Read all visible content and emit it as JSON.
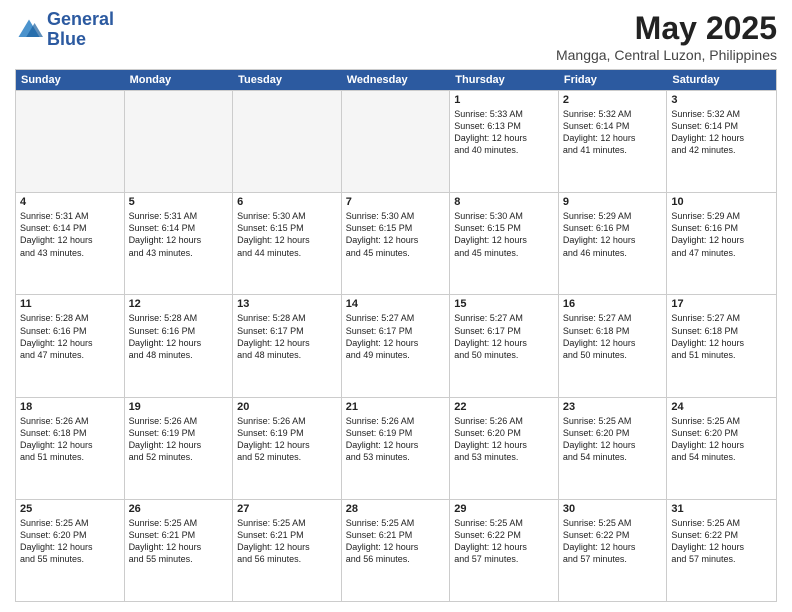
{
  "header": {
    "logo_line1": "General",
    "logo_line2": "Blue",
    "month": "May 2025",
    "location": "Mangga, Central Luzon, Philippines"
  },
  "weekdays": [
    "Sunday",
    "Monday",
    "Tuesday",
    "Wednesday",
    "Thursday",
    "Friday",
    "Saturday"
  ],
  "weeks": [
    [
      {
        "day": "",
        "empty": true
      },
      {
        "day": "",
        "empty": true
      },
      {
        "day": "",
        "empty": true
      },
      {
        "day": "",
        "empty": true
      },
      {
        "day": "1",
        "info": "Sunrise: 5:33 AM\nSunset: 6:13 PM\nDaylight: 12 hours\nand 40 minutes."
      },
      {
        "day": "2",
        "info": "Sunrise: 5:32 AM\nSunset: 6:14 PM\nDaylight: 12 hours\nand 41 minutes."
      },
      {
        "day": "3",
        "info": "Sunrise: 5:32 AM\nSunset: 6:14 PM\nDaylight: 12 hours\nand 42 minutes."
      }
    ],
    [
      {
        "day": "4",
        "info": "Sunrise: 5:31 AM\nSunset: 6:14 PM\nDaylight: 12 hours\nand 43 minutes."
      },
      {
        "day": "5",
        "info": "Sunrise: 5:31 AM\nSunset: 6:14 PM\nDaylight: 12 hours\nand 43 minutes."
      },
      {
        "day": "6",
        "info": "Sunrise: 5:30 AM\nSunset: 6:15 PM\nDaylight: 12 hours\nand 44 minutes."
      },
      {
        "day": "7",
        "info": "Sunrise: 5:30 AM\nSunset: 6:15 PM\nDaylight: 12 hours\nand 45 minutes."
      },
      {
        "day": "8",
        "info": "Sunrise: 5:30 AM\nSunset: 6:15 PM\nDaylight: 12 hours\nand 45 minutes."
      },
      {
        "day": "9",
        "info": "Sunrise: 5:29 AM\nSunset: 6:16 PM\nDaylight: 12 hours\nand 46 minutes."
      },
      {
        "day": "10",
        "info": "Sunrise: 5:29 AM\nSunset: 6:16 PM\nDaylight: 12 hours\nand 47 minutes."
      }
    ],
    [
      {
        "day": "11",
        "info": "Sunrise: 5:28 AM\nSunset: 6:16 PM\nDaylight: 12 hours\nand 47 minutes."
      },
      {
        "day": "12",
        "info": "Sunrise: 5:28 AM\nSunset: 6:16 PM\nDaylight: 12 hours\nand 48 minutes."
      },
      {
        "day": "13",
        "info": "Sunrise: 5:28 AM\nSunset: 6:17 PM\nDaylight: 12 hours\nand 48 minutes."
      },
      {
        "day": "14",
        "info": "Sunrise: 5:27 AM\nSunset: 6:17 PM\nDaylight: 12 hours\nand 49 minutes."
      },
      {
        "day": "15",
        "info": "Sunrise: 5:27 AM\nSunset: 6:17 PM\nDaylight: 12 hours\nand 50 minutes."
      },
      {
        "day": "16",
        "info": "Sunrise: 5:27 AM\nSunset: 6:18 PM\nDaylight: 12 hours\nand 50 minutes."
      },
      {
        "day": "17",
        "info": "Sunrise: 5:27 AM\nSunset: 6:18 PM\nDaylight: 12 hours\nand 51 minutes."
      }
    ],
    [
      {
        "day": "18",
        "info": "Sunrise: 5:26 AM\nSunset: 6:18 PM\nDaylight: 12 hours\nand 51 minutes."
      },
      {
        "day": "19",
        "info": "Sunrise: 5:26 AM\nSunset: 6:19 PM\nDaylight: 12 hours\nand 52 minutes."
      },
      {
        "day": "20",
        "info": "Sunrise: 5:26 AM\nSunset: 6:19 PM\nDaylight: 12 hours\nand 52 minutes."
      },
      {
        "day": "21",
        "info": "Sunrise: 5:26 AM\nSunset: 6:19 PM\nDaylight: 12 hours\nand 53 minutes."
      },
      {
        "day": "22",
        "info": "Sunrise: 5:26 AM\nSunset: 6:20 PM\nDaylight: 12 hours\nand 53 minutes."
      },
      {
        "day": "23",
        "info": "Sunrise: 5:25 AM\nSunset: 6:20 PM\nDaylight: 12 hours\nand 54 minutes."
      },
      {
        "day": "24",
        "info": "Sunrise: 5:25 AM\nSunset: 6:20 PM\nDaylight: 12 hours\nand 54 minutes."
      }
    ],
    [
      {
        "day": "25",
        "info": "Sunrise: 5:25 AM\nSunset: 6:20 PM\nDaylight: 12 hours\nand 55 minutes."
      },
      {
        "day": "26",
        "info": "Sunrise: 5:25 AM\nSunset: 6:21 PM\nDaylight: 12 hours\nand 55 minutes."
      },
      {
        "day": "27",
        "info": "Sunrise: 5:25 AM\nSunset: 6:21 PM\nDaylight: 12 hours\nand 56 minutes."
      },
      {
        "day": "28",
        "info": "Sunrise: 5:25 AM\nSunset: 6:21 PM\nDaylight: 12 hours\nand 56 minutes."
      },
      {
        "day": "29",
        "info": "Sunrise: 5:25 AM\nSunset: 6:22 PM\nDaylight: 12 hours\nand 57 minutes."
      },
      {
        "day": "30",
        "info": "Sunrise: 5:25 AM\nSunset: 6:22 PM\nDaylight: 12 hours\nand 57 minutes."
      },
      {
        "day": "31",
        "info": "Sunrise: 5:25 AM\nSunset: 6:22 PM\nDaylight: 12 hours\nand 57 minutes."
      }
    ]
  ]
}
